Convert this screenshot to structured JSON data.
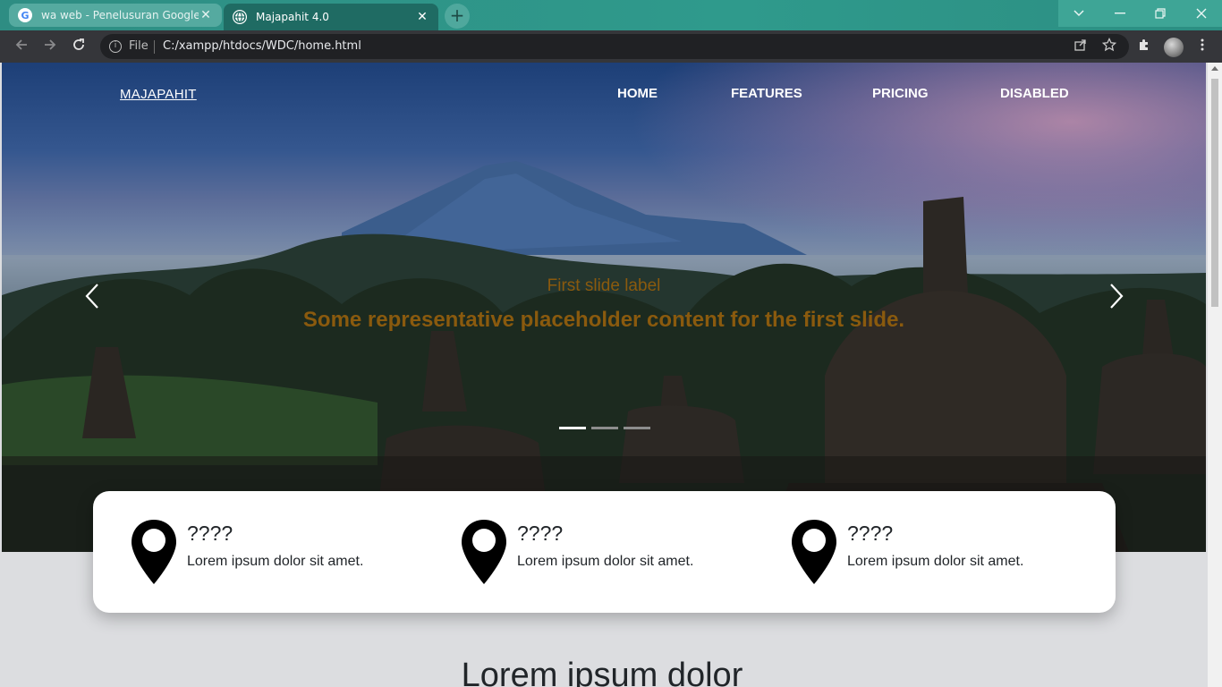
{
  "browser": {
    "tabs": [
      {
        "title": "wa web - Penelusuran Google",
        "favicon": "G",
        "active": false
      },
      {
        "title": "Majapahit 4.0",
        "favicon": "globe",
        "active": true
      }
    ],
    "new_tab_label": "+",
    "address": {
      "scheme_label": "File",
      "url": "C:/xampp/htdocs/WDC/home.html"
    },
    "accent_color": "#2e8d83"
  },
  "navbar": {
    "brand": "MAJAPAHIT",
    "links": [
      "HOME",
      "FEATURES",
      "PRICING",
      "DISABLED"
    ]
  },
  "carousel": {
    "label": "First slide label",
    "text": "Some representative placeholder content for the first slide.",
    "caption_color": "#8a5a0e",
    "slides": 3,
    "active_slide": 1
  },
  "features": [
    {
      "title": "????",
      "text": "Lorem ipsum dolor sit amet.",
      "icon": "map-pin-icon"
    },
    {
      "title": "????",
      "text": "Lorem ipsum dolor sit amet.",
      "icon": "map-pin-icon"
    },
    {
      "title": "????",
      "text": "Lorem ipsum dolor sit amet.",
      "icon": "map-pin-icon"
    }
  ],
  "section": {
    "heading": "Lorem ipsum dolor"
  }
}
